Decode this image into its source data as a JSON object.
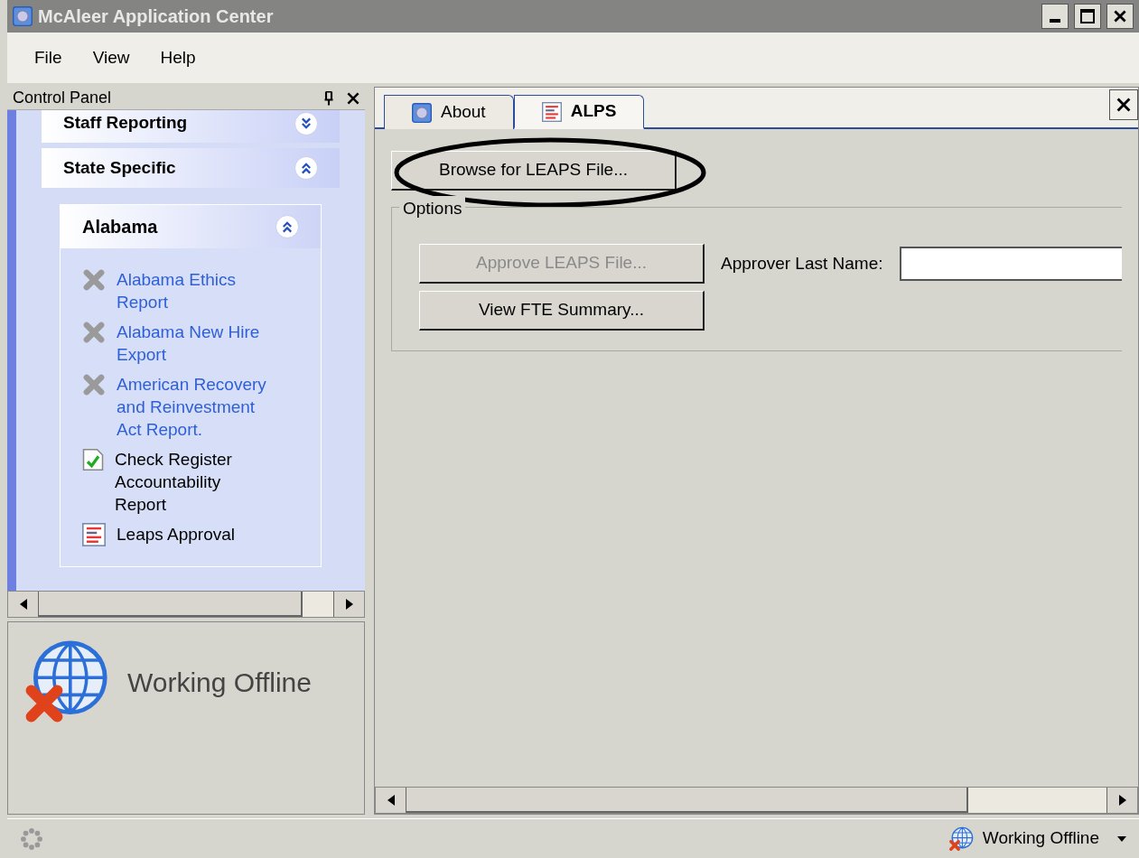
{
  "window": {
    "title": "McAleer Application Center"
  },
  "menu": [
    "File",
    "View",
    "Help"
  ],
  "control_panel": {
    "title": "Control Panel",
    "groups": [
      {
        "title": "Staff Reporting",
        "expanded": false
      },
      {
        "title": "State Specific",
        "expanded": true
      }
    ],
    "subgroup": {
      "title": "Alabama",
      "expanded": true,
      "items": [
        {
          "label": "Alabama Ethics\nReport",
          "kind": "unavailable"
        },
        {
          "label": "Alabama New Hire\nExport",
          "kind": "unavailable"
        },
        {
          "label": "American Recovery\nand Reinvestment\nAct Report.",
          "kind": "unavailable"
        },
        {
          "label": "Check Register\nAccountability\nReport",
          "kind": "checked-document"
        },
        {
          "label": "Leaps Approval",
          "kind": "report"
        }
      ]
    }
  },
  "connection": {
    "status": "Working Offline"
  },
  "tabs": [
    {
      "label": "About",
      "selected": false
    },
    {
      "label": "ALPS",
      "selected": true
    }
  ],
  "alps": {
    "browse_button": "Browse for LEAPS File...",
    "options": {
      "title": "Options",
      "approve_button": {
        "label": "Approve LEAPS File...",
        "disabled": true
      },
      "fte_button": {
        "label": "View FTE Summary...",
        "disabled": false
      },
      "approver_label": "Approver Last Name:"
    }
  },
  "status_bar": {
    "status": "Working Offline"
  }
}
